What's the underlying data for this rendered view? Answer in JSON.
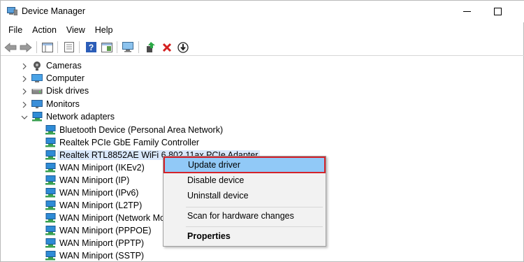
{
  "window": {
    "title": "Device Manager",
    "icon": "device-manager-icon"
  },
  "menu": [
    "File",
    "Action",
    "View",
    "Help"
  ],
  "toolbar": {
    "buttons": [
      "back-arrow-icon",
      "forward-arrow-icon",
      "show-tree-icon",
      "properties-icon",
      "help-icon",
      "view-panel-icon",
      "monitor-icon",
      "update-driver-icon",
      "uninstall-icon",
      "download-icon"
    ]
  },
  "tree": {
    "categories": [
      {
        "label": "Cameras",
        "icon": "camera-icon",
        "expanded": false
      },
      {
        "label": "Computer",
        "icon": "computer-icon",
        "expanded": false
      },
      {
        "label": "Disk drives",
        "icon": "disk-drive-icon",
        "expanded": false
      },
      {
        "label": "Monitors",
        "icon": "monitor-icon",
        "expanded": false
      },
      {
        "label": "Network adapters",
        "icon": "network-adapter-icon",
        "expanded": true
      }
    ],
    "network_adapters": [
      "Bluetooth Device (Personal Area Network)",
      "Realtek PCIe GbE Family Controller",
      "Realtek RTL8852AE WiFi 6 802.11ax PCIe Adapter",
      "WAN Miniport (IKEv2)",
      "WAN Miniport (IP)",
      "WAN Miniport (IPv6)",
      "WAN Miniport (L2TP)",
      "WAN Miniport (Network Monitor)",
      "WAN Miniport (PPPOE)",
      "WAN Miniport (PPTP)",
      "WAN Miniport (SSTP)"
    ],
    "selected_index": 2
  },
  "context_menu": {
    "items": [
      "Update driver",
      "Disable device",
      "Uninstall device",
      "Scan for hardware changes",
      "Properties"
    ],
    "highlighted": "Update driver",
    "highlight_outline_color": "#d4222a"
  },
  "colors": {
    "selection": "#d9e8fb",
    "menu_highlight": "#91c9f7",
    "adapter_icon": "#2e8bd6"
  }
}
